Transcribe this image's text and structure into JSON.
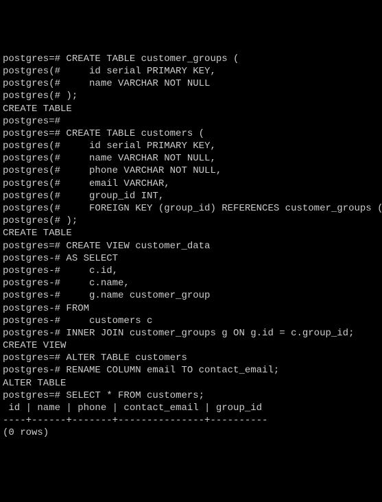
{
  "lines": [
    "postgres=# CREATE TABLE customer_groups (",
    "postgres(#     id serial PRIMARY KEY,",
    "postgres(#     name VARCHAR NOT NULL",
    "postgres(# );",
    "CREATE TABLE",
    "postgres=#",
    "postgres=# CREATE TABLE customers (",
    "postgres(#     id serial PRIMARY KEY,",
    "postgres(#     name VARCHAR NOT NULL,",
    "postgres(#     phone VARCHAR NOT NULL,",
    "postgres(#     email VARCHAR,",
    "postgres(#     group_id INT,",
    "postgres(#     FOREIGN KEY (group_id) REFERENCES customer_groups (id)",
    "postgres(# );",
    "CREATE TABLE",
    "postgres=# CREATE VIEW customer_data",
    "postgres-# AS SELECT",
    "postgres-#     c.id,",
    "postgres-#     c.name,",
    "postgres-#     g.name customer_group",
    "postgres-# FROM",
    "postgres-#     customers c",
    "postgres-# INNER JOIN customer_groups g ON g.id = c.group_id;",
    "CREATE VIEW",
    "postgres=# ALTER TABLE customers",
    "postgres-# RENAME COLUMN email TO contact_email;",
    "ALTER TABLE",
    "postgres=# SELECT * FROM customers;",
    " id | name | phone | contact_email | group_id",
    "----+------+-------+---------------+----------",
    "(0 rows)",
    ""
  ]
}
